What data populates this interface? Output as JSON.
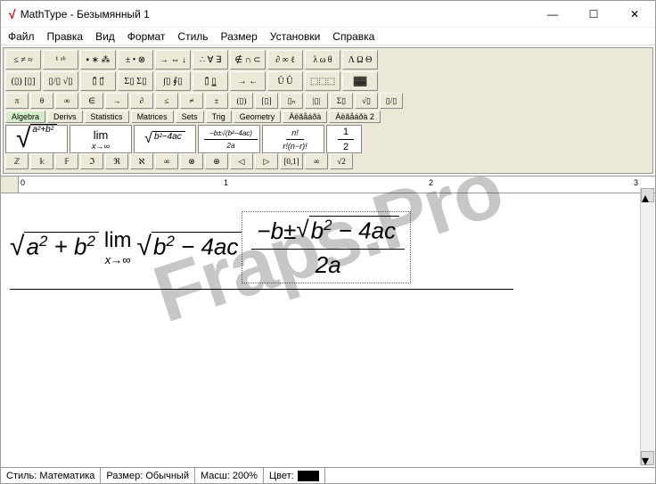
{
  "window": {
    "title": "MathType - Безымянный 1"
  },
  "menu": [
    "Файл",
    "Правка",
    "Вид",
    "Формат",
    "Стиль",
    "Размер",
    "Установки",
    "Справка"
  ],
  "toolbar_row1": [
    "≤ ≠ ≈",
    "¹ ᵃᵇ",
    "▪ ∗ ⁂",
    "± • ⊗",
    "→ ⇔ ↓",
    "∴ ∀ ∃",
    "∉ ∩ ⊂",
    "∂ ∞ ℓ",
    "λ ω θ",
    "Λ Ω Θ"
  ],
  "toolbar_row2": [
    "(▯) [▯]",
    "▯/▯ √▯",
    "▯̄ ▯⃗",
    "Σ▯ Σ▯",
    "∫▯ ∮▯",
    "▯̄ ▯̲",
    "→ ←",
    "Ū Û",
    "⬚⬚⬚",
    "▓▓"
  ],
  "toolbar_row3": [
    "π",
    "θ",
    "∞",
    "∈",
    "→",
    "∂",
    "≤",
    "≠",
    "±",
    "(▯)",
    "[▯]",
    "▯ₙ",
    "|▯|",
    "Σ▯",
    "√▯",
    "▯/▯"
  ],
  "tabs": [
    {
      "label": "Algebra",
      "active": true
    },
    {
      "label": "Derivs",
      "active": false
    },
    {
      "label": "Statistics",
      "active": false
    },
    {
      "label": "Matrices",
      "active": false
    },
    {
      "label": "Sets",
      "active": false
    },
    {
      "label": "Trig",
      "active": false
    },
    {
      "label": "Geometry",
      "active": false
    },
    {
      "label": "Àëãåáðà",
      "active": false
    },
    {
      "label": "Àëãåáðà 2",
      "active": false
    }
  ],
  "templates": {
    "t1": "√(a²+b²)",
    "t2_top": "lim",
    "t2_bot": "x→∞",
    "t3": "√(b²−4ac)",
    "t4_top": "−b±√(b²−4ac)",
    "t4_bot": "2a",
    "t5_top": "n!",
    "t5_bot": "r!(n−r)!",
    "t6_top": "1",
    "t6_bot": "2"
  },
  "toolbar_row4": [
    "ℤ",
    "𝕜",
    "𝔽",
    "ℑ",
    "ℜ",
    "ℵ",
    "∞",
    "⊗",
    "⊕",
    "◁",
    "▷",
    "[0,1]",
    "∞",
    "√2"
  ],
  "ruler": {
    "marks": [
      "0",
      "1",
      "2",
      "3"
    ]
  },
  "editor_formula": {
    "sqrt1_body": "a² + b²",
    "lim_top": "lim",
    "lim_bot": "x→∞",
    "sqrt2_body": "b² − 4ac",
    "frac_top_prefix": "−b ± ",
    "frac_sqrt_body": "b² − 4ac",
    "frac_bot": "2a"
  },
  "status": {
    "style_label": "Стиль:",
    "style_value": "Математика",
    "size_label": "Размер:",
    "size_value": "Обычный",
    "zoom_label": "Масш:",
    "zoom_value": "200%",
    "color_label": "Цвет:"
  },
  "watermark": "Fraps.Pro"
}
